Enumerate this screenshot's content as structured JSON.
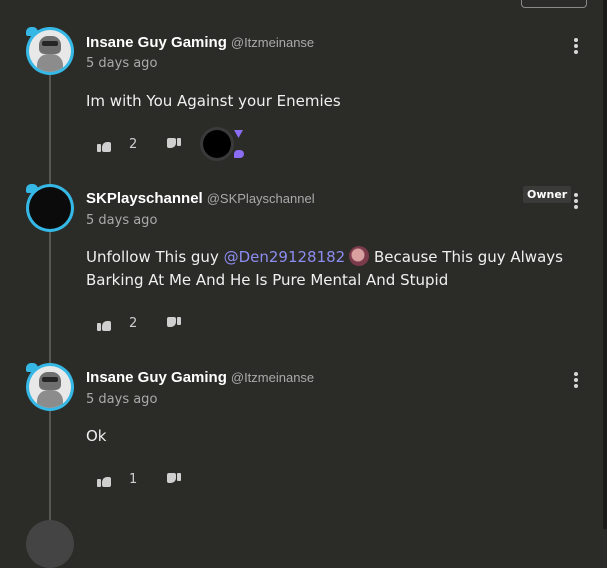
{
  "comments": [
    {
      "name": "Insane Guy Gaming",
      "handle": "@Itzmeinanse",
      "time": "5 days ago",
      "text": "Im with You Against your Enemies",
      "likes": "2"
    },
    {
      "name": "SKPlayschannel",
      "handle": "@SKPlayschannel",
      "time": "5 days ago",
      "badge": "Owner",
      "text_before": "Unfollow This guy ",
      "mention": "@Den29128182",
      "text_after": " Because This guy Always Barking At Me And He Is Pure Mental And Stupid",
      "likes": "2"
    },
    {
      "name": "Insane Guy Gaming",
      "handle": "@Itzmeinanse",
      "time": "5 days ago",
      "text": "Ok",
      "likes": "1"
    }
  ],
  "icons": {
    "like": "thumbs-up-icon",
    "dislike": "thumbs-down-icon",
    "menu": "more-vertical-icon"
  },
  "colors": {
    "background": "#2b2b28",
    "avatar_ring": "#36b8e6",
    "mention": "#8c8df0",
    "creator_heart": "#8a6df2"
  }
}
